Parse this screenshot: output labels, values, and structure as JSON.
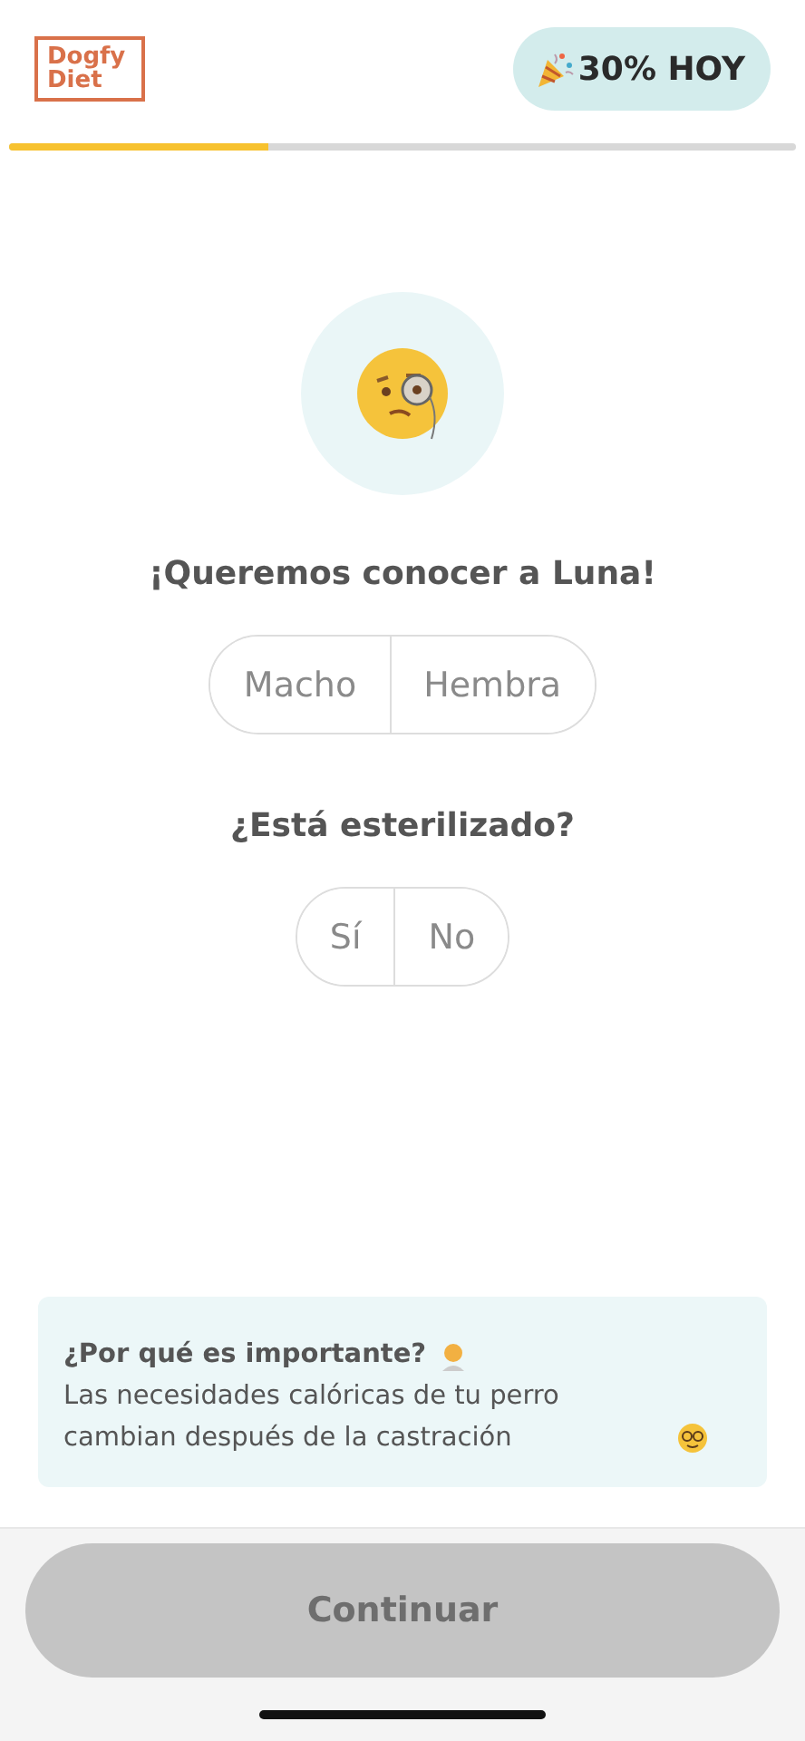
{
  "header": {
    "logo": [
      "Dogfy",
      "Diet"
    ],
    "promo": "30% HOY"
  },
  "progress": {
    "level": 0.33
  },
  "questions": [
    {
      "title": "¡Queremos conocer a Luna!",
      "options": [
        {
          "label": "Macho",
          "selected": false
        },
        {
          "label": "Hembra",
          "selected": false
        }
      ]
    },
    {
      "title": "¿Está esterilizado?",
      "options": [
        {
          "label": "Sí",
          "selected": false
        },
        {
          "label": "No",
          "selected": false
        }
      ]
    }
  ],
  "info": {
    "title": "¿Por qué es importante?",
    "text": "Las necesidades calóricas de tu perro cambian después de la castración"
  },
  "continue_button": {
    "label": "Continuar",
    "disabled": true
  }
}
